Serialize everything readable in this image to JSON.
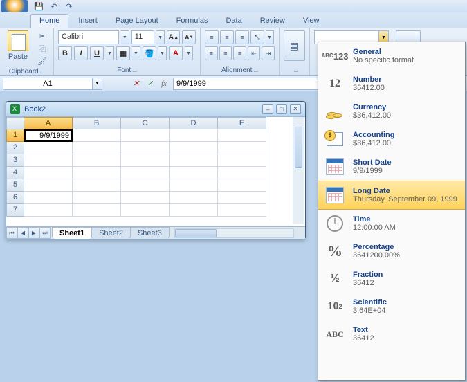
{
  "tabs": [
    "Home",
    "Insert",
    "Page Layout",
    "Formulas",
    "Data",
    "Review",
    "View"
  ],
  "activeTab": "Home",
  "ribbon": {
    "clipboard": {
      "label": "Clipboard",
      "paste": "Paste"
    },
    "font": {
      "label": "Font",
      "name": "Calibri",
      "size": "11"
    },
    "alignment": {
      "label": "Alignment"
    }
  },
  "namebox": "A1",
  "formula": "9/9/1999",
  "workbook": {
    "title": "Book2",
    "columns": [
      "A",
      "B",
      "C",
      "D",
      "E"
    ],
    "rows": [
      "1",
      "2",
      "3",
      "4",
      "5",
      "6",
      "7"
    ],
    "activeCell": "A1",
    "cellValue": "9/9/1999",
    "sheets": [
      "Sheet1",
      "Sheet2",
      "Sheet3"
    ],
    "activeSheet": "Sheet1"
  },
  "numberFormats": [
    {
      "id": "general",
      "title": "General",
      "sample": "No specific format",
      "iconText": "ABC123"
    },
    {
      "id": "number",
      "title": "Number",
      "sample": "36412.00",
      "iconText": "12"
    },
    {
      "id": "currency",
      "title": "Currency",
      "sample": "$36,412.00",
      "iconText": "coins"
    },
    {
      "id": "accounting",
      "title": "Accounting",
      "sample": " $36,412.00",
      "iconText": "ledger"
    },
    {
      "id": "shortdate",
      "title": "Short Date",
      "sample": "9/9/1999",
      "iconText": "cal"
    },
    {
      "id": "longdate",
      "title": "Long Date",
      "sample": "Thursday, September 09, 1999",
      "iconText": "cal",
      "selected": true
    },
    {
      "id": "time",
      "title": "Time",
      "sample": "12:00:00 AM",
      "iconText": "clock"
    },
    {
      "id": "percentage",
      "title": "Percentage",
      "sample": "3641200.00%",
      "iconText": "%"
    },
    {
      "id": "fraction",
      "title": "Fraction",
      "sample": "36412",
      "iconText": "1/2"
    },
    {
      "id": "scientific",
      "title": "Scientific",
      "sample": "3.64E+04",
      "iconText": "10^2"
    },
    {
      "id": "text",
      "title": "Text",
      "sample": "36412",
      "iconText": "ABC"
    }
  ]
}
